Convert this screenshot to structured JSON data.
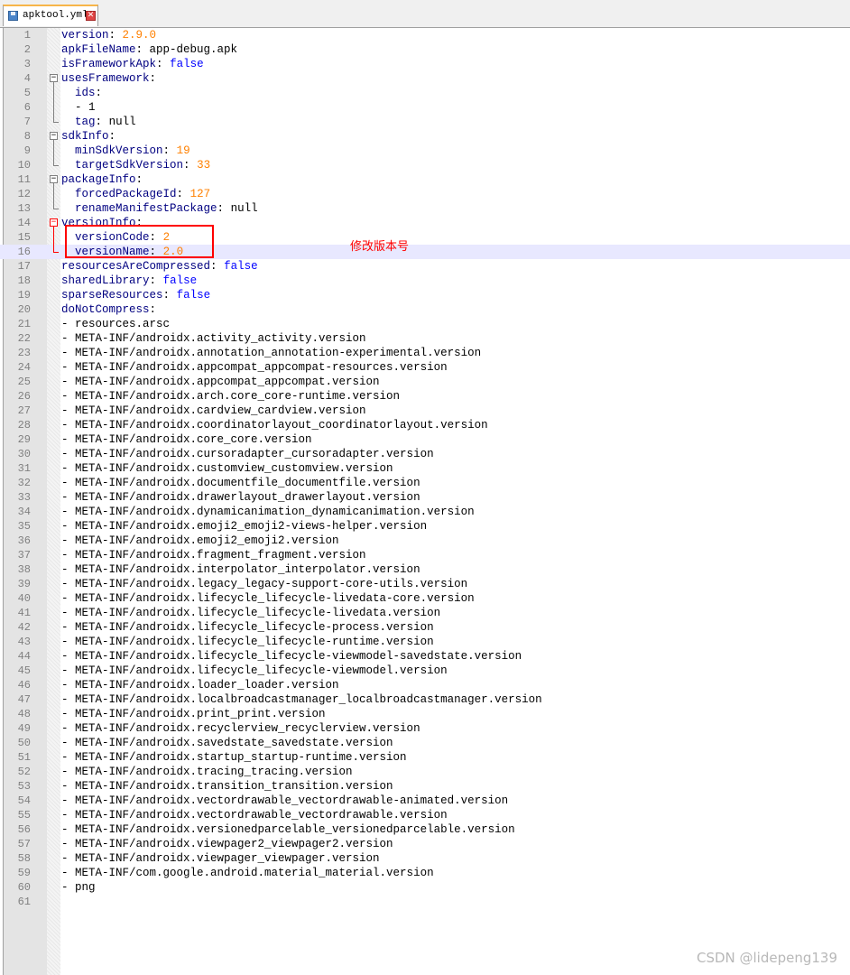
{
  "tab": {
    "filename": "apktool.yml",
    "close_glyph": "✕"
  },
  "lines": [
    {
      "n": "1",
      "k": "version",
      "v": "2.9.0",
      "t": "num"
    },
    {
      "n": "2",
      "k": "apkFileName",
      "v": "app-debug.apk",
      "t": "plain"
    },
    {
      "n": "3",
      "k": "isFrameworkApk",
      "v": "false",
      "t": "bool"
    },
    {
      "n": "4",
      "k": "usesFramework",
      "v": "",
      "t": "plain"
    },
    {
      "n": "5",
      "i": "  ",
      "k": "ids",
      "v": "",
      "t": "plain"
    },
    {
      "n": "6",
      "raw": "  - 1"
    },
    {
      "n": "7",
      "i": "  ",
      "k": "tag",
      "v": "null",
      "t": "plain"
    },
    {
      "n": "8",
      "k": "sdkInfo",
      "v": "",
      "t": "plain"
    },
    {
      "n": "9",
      "i": "  ",
      "k": "minSdkVersion",
      "v": "19",
      "t": "num"
    },
    {
      "n": "10",
      "i": "  ",
      "k": "targetSdkVersion",
      "v": "33",
      "t": "num"
    },
    {
      "n": "11",
      "k": "packageInfo",
      "v": "",
      "t": "plain"
    },
    {
      "n": "12",
      "i": "  ",
      "k": "forcedPackageId",
      "v": "127",
      "t": "num"
    },
    {
      "n": "13",
      "i": "  ",
      "k": "renameManifestPackage",
      "v": "null",
      "t": "plain"
    },
    {
      "n": "14",
      "k": "versionInfo",
      "v": "",
      "t": "plain"
    },
    {
      "n": "15",
      "i": "  ",
      "k": "versionCode",
      "v": "2",
      "t": "num"
    },
    {
      "n": "16",
      "i": "  ",
      "k": "versionName",
      "v": "2.0",
      "t": "num"
    },
    {
      "n": "17",
      "k": "resourcesAreCompressed",
      "v": "false",
      "t": "bool"
    },
    {
      "n": "18",
      "k": "sharedLibrary",
      "v": "false",
      "t": "bool"
    },
    {
      "n": "19",
      "k": "sparseResources",
      "v": "false",
      "t": "bool"
    },
    {
      "n": "20",
      "k": "doNotCompress",
      "v": "",
      "t": "plain"
    },
    {
      "n": "21",
      "raw": "- resources.arsc"
    },
    {
      "n": "22",
      "raw": "- META-INF/androidx.activity_activity.version"
    },
    {
      "n": "23",
      "raw": "- META-INF/androidx.annotation_annotation-experimental.version"
    },
    {
      "n": "24",
      "raw": "- META-INF/androidx.appcompat_appcompat-resources.version"
    },
    {
      "n": "25",
      "raw": "- META-INF/androidx.appcompat_appcompat.version"
    },
    {
      "n": "26",
      "raw": "- META-INF/androidx.arch.core_core-runtime.version"
    },
    {
      "n": "27",
      "raw": "- META-INF/androidx.cardview_cardview.version"
    },
    {
      "n": "28",
      "raw": "- META-INF/androidx.coordinatorlayout_coordinatorlayout.version"
    },
    {
      "n": "29",
      "raw": "- META-INF/androidx.core_core.version"
    },
    {
      "n": "30",
      "raw": "- META-INF/androidx.cursoradapter_cursoradapter.version"
    },
    {
      "n": "31",
      "raw": "- META-INF/androidx.customview_customview.version"
    },
    {
      "n": "32",
      "raw": "- META-INF/androidx.documentfile_documentfile.version"
    },
    {
      "n": "33",
      "raw": "- META-INF/androidx.drawerlayout_drawerlayout.version"
    },
    {
      "n": "34",
      "raw": "- META-INF/androidx.dynamicanimation_dynamicanimation.version"
    },
    {
      "n": "35",
      "raw": "- META-INF/androidx.emoji2_emoji2-views-helper.version"
    },
    {
      "n": "36",
      "raw": "- META-INF/androidx.emoji2_emoji2.version"
    },
    {
      "n": "37",
      "raw": "- META-INF/androidx.fragment_fragment.version"
    },
    {
      "n": "38",
      "raw": "- META-INF/androidx.interpolator_interpolator.version"
    },
    {
      "n": "39",
      "raw": "- META-INF/androidx.legacy_legacy-support-core-utils.version"
    },
    {
      "n": "40",
      "raw": "- META-INF/androidx.lifecycle_lifecycle-livedata-core.version"
    },
    {
      "n": "41",
      "raw": "- META-INF/androidx.lifecycle_lifecycle-livedata.version"
    },
    {
      "n": "42",
      "raw": "- META-INF/androidx.lifecycle_lifecycle-process.version"
    },
    {
      "n": "43",
      "raw": "- META-INF/androidx.lifecycle_lifecycle-runtime.version"
    },
    {
      "n": "44",
      "raw": "- META-INF/androidx.lifecycle_lifecycle-viewmodel-savedstate.version"
    },
    {
      "n": "45",
      "raw": "- META-INF/androidx.lifecycle_lifecycle-viewmodel.version"
    },
    {
      "n": "46",
      "raw": "- META-INF/androidx.loader_loader.version"
    },
    {
      "n": "47",
      "raw": "- META-INF/androidx.localbroadcastmanager_localbroadcastmanager.version"
    },
    {
      "n": "48",
      "raw": "- META-INF/androidx.print_print.version"
    },
    {
      "n": "49",
      "raw": "- META-INF/androidx.recyclerview_recyclerview.version"
    },
    {
      "n": "50",
      "raw": "- META-INF/androidx.savedstate_savedstate.version"
    },
    {
      "n": "51",
      "raw": "- META-INF/androidx.startup_startup-runtime.version"
    },
    {
      "n": "52",
      "raw": "- META-INF/androidx.tracing_tracing.version"
    },
    {
      "n": "53",
      "raw": "- META-INF/androidx.transition_transition.version"
    },
    {
      "n": "54",
      "raw": "- META-INF/androidx.vectordrawable_vectordrawable-animated.version"
    },
    {
      "n": "55",
      "raw": "- META-INF/androidx.vectordrawable_vectordrawable.version"
    },
    {
      "n": "56",
      "raw": "- META-INF/androidx.versionedparcelable_versionedparcelable.version"
    },
    {
      "n": "57",
      "raw": "- META-INF/androidx.viewpager2_viewpager2.version"
    },
    {
      "n": "58",
      "raw": "- META-INF/androidx.viewpager_viewpager.version"
    },
    {
      "n": "59",
      "raw": "- META-INF/com.google.android.material_material.version"
    },
    {
      "n": "60",
      "raw": "- png"
    },
    {
      "n": "61",
      "raw": ""
    }
  ],
  "current_line": "16",
  "annotation": "修改版本号",
  "watermark": "CSDN @lidepeng139",
  "colors": {
    "key": "#000080",
    "number": "#ff8000",
    "boolean": "#0000ff",
    "highlight": "#ff0000",
    "current_line": "#e8e8ff"
  }
}
